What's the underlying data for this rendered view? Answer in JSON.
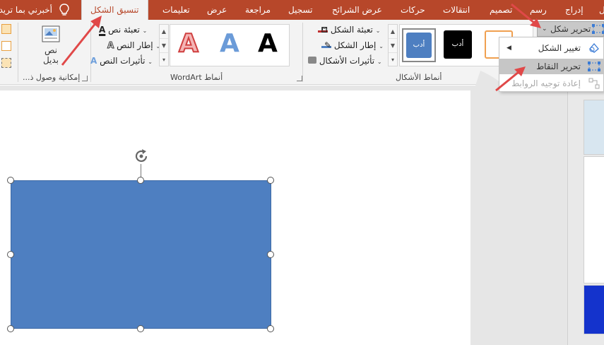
{
  "tabs": {
    "tell_me": "أخبرني بما تريد",
    "format": "تنسيق الشكل",
    "help": "تعليمات",
    "view": "عرض",
    "review": "مراجعة",
    "record": "تسجيل",
    "slideshow": "عرض الشرائح",
    "animations": "حركات",
    "transitions": "انتقالات",
    "design": "تصميم",
    "draw": "رسم",
    "insert": "إدراج",
    "home": "ل"
  },
  "ribbon": {
    "alt_text": {
      "label_line1": "نص",
      "label_line2": "بديل",
      "group": "إمكانية وصول ذ..."
    },
    "wordart": {
      "text_fill": "تعبئة نص",
      "text_outline": "إطار النص",
      "text_effects": "تأثيرات النص",
      "group": "أنماط WordArt",
      "letter": "A"
    },
    "shape_styles": {
      "shape_fill": "تعبئة الشكل",
      "shape_outline": "إطار الشكل",
      "shape_effects": "تأثيرات الأشكال",
      "group": "أنماط الأشكال",
      "thumb_text": "أدب",
      "thumb_partial": "ب"
    },
    "edit_shape": "تحرير شكل"
  },
  "menu": {
    "change_shape": "تغيير الشكل",
    "edit_points": "تحرير النقاط",
    "reroute": "إعادة توجيه الروابط"
  },
  "colors": {
    "tab_bar": "#b7472a",
    "shape_blue": "#4e7fc1",
    "arrow_red": "#e04848"
  }
}
